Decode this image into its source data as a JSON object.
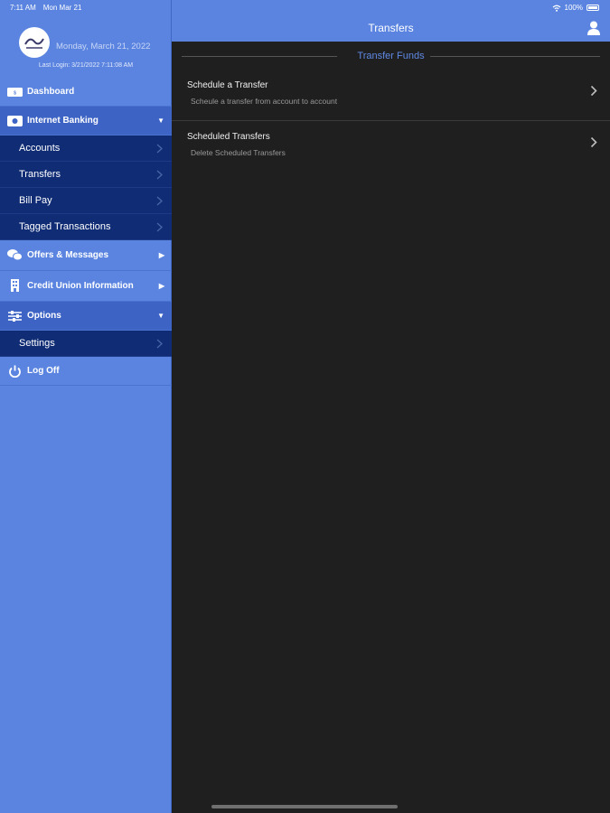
{
  "status_bar": {
    "time": "7:11 AM",
    "date": "Mon Mar 21",
    "battery": "100%"
  },
  "sidebar": {
    "profile": {
      "date": "Monday, March 21, 2022",
      "last_login": "Last Login: 3/21/2022 7:11:08 AM"
    },
    "dashboard": "Dashboard",
    "internet_banking": "Internet Banking",
    "internet_banking_sub": [
      "Accounts",
      "Transfers",
      "Bill Pay",
      "Tagged Transactions"
    ],
    "offers": "Offers & Messages",
    "cu_info": "Credit Union Information",
    "options": "Options",
    "options_sub": [
      "Settings"
    ],
    "logoff": "Log Off"
  },
  "header": {
    "title": "Transfers"
  },
  "main": {
    "section": "Transfer Funds",
    "rows": [
      {
        "title": "Schedule a Transfer",
        "subtitle": "Scheule a transfer from account to account"
      },
      {
        "title": "Scheduled Transfers",
        "subtitle": "Delete Scheduled Transfers"
      }
    ]
  },
  "colors": {
    "accent": "#5a84e0",
    "sub_menu": "#0f2c75",
    "background": "#1f1f1f"
  },
  "icons": [
    "wifi-icon",
    "battery-icon",
    "dashboard-icon",
    "bank-icon",
    "messages-icon",
    "building-icon",
    "sliders-icon",
    "power-icon",
    "chevron-right-icon",
    "user-icon"
  ]
}
